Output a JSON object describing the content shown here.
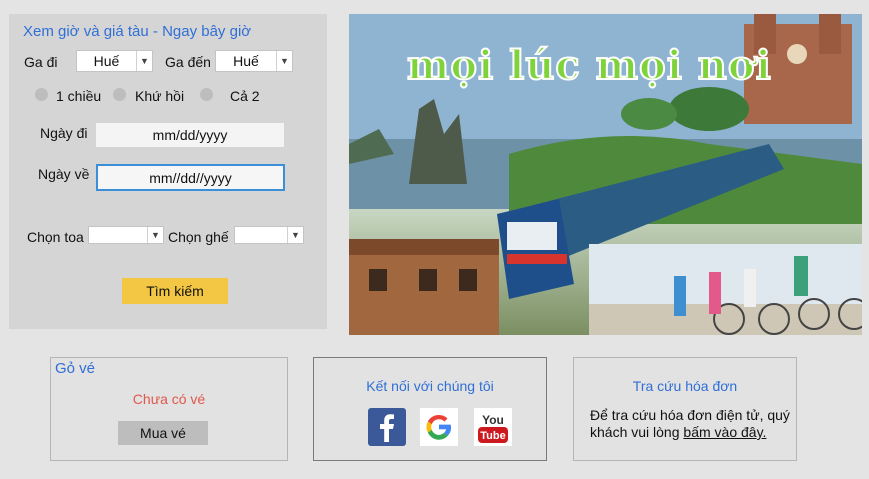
{
  "search": {
    "title": "Xem giờ và giá tàu - Ngay bây giờ",
    "from_label": "Ga đi",
    "from_value": "Huế",
    "to_label": "Ga đến",
    "to_value": "Huế",
    "trip_types": [
      "1 chiều",
      "Khứ hồi",
      "Cả 2"
    ],
    "depart_label": "Ngày đi",
    "depart_value": "mm/dd/yyyy",
    "return_label": "Ngày về",
    "return_value": "mm//dd//yyyy",
    "car_label": "Chọn toa",
    "car_value": "",
    "seat_label": "Chọn ghế",
    "seat_value": "",
    "submit_label": "Tìm kiếm"
  },
  "banner": {
    "slogan": "mọi lúc mọi nơi"
  },
  "cart": {
    "title": "Gỏ vé",
    "empty_text": "Chưa có vé",
    "buy_label": "Mua vé"
  },
  "connect": {
    "title": "Kết nối với chúng tôi",
    "networks": [
      "facebook-icon",
      "google-icon",
      "youtube-icon"
    ]
  },
  "invoice": {
    "title": "Tra cứu hóa đơn",
    "text": "Để tra cứu hóa đơn điện tử, quý khách vui lòng ",
    "link_text": "bấm vào đây."
  },
  "colors": {
    "accent_blue": "#2f6fd6",
    "button_yellow": "#f3c743",
    "empty_red": "#e0574b"
  }
}
